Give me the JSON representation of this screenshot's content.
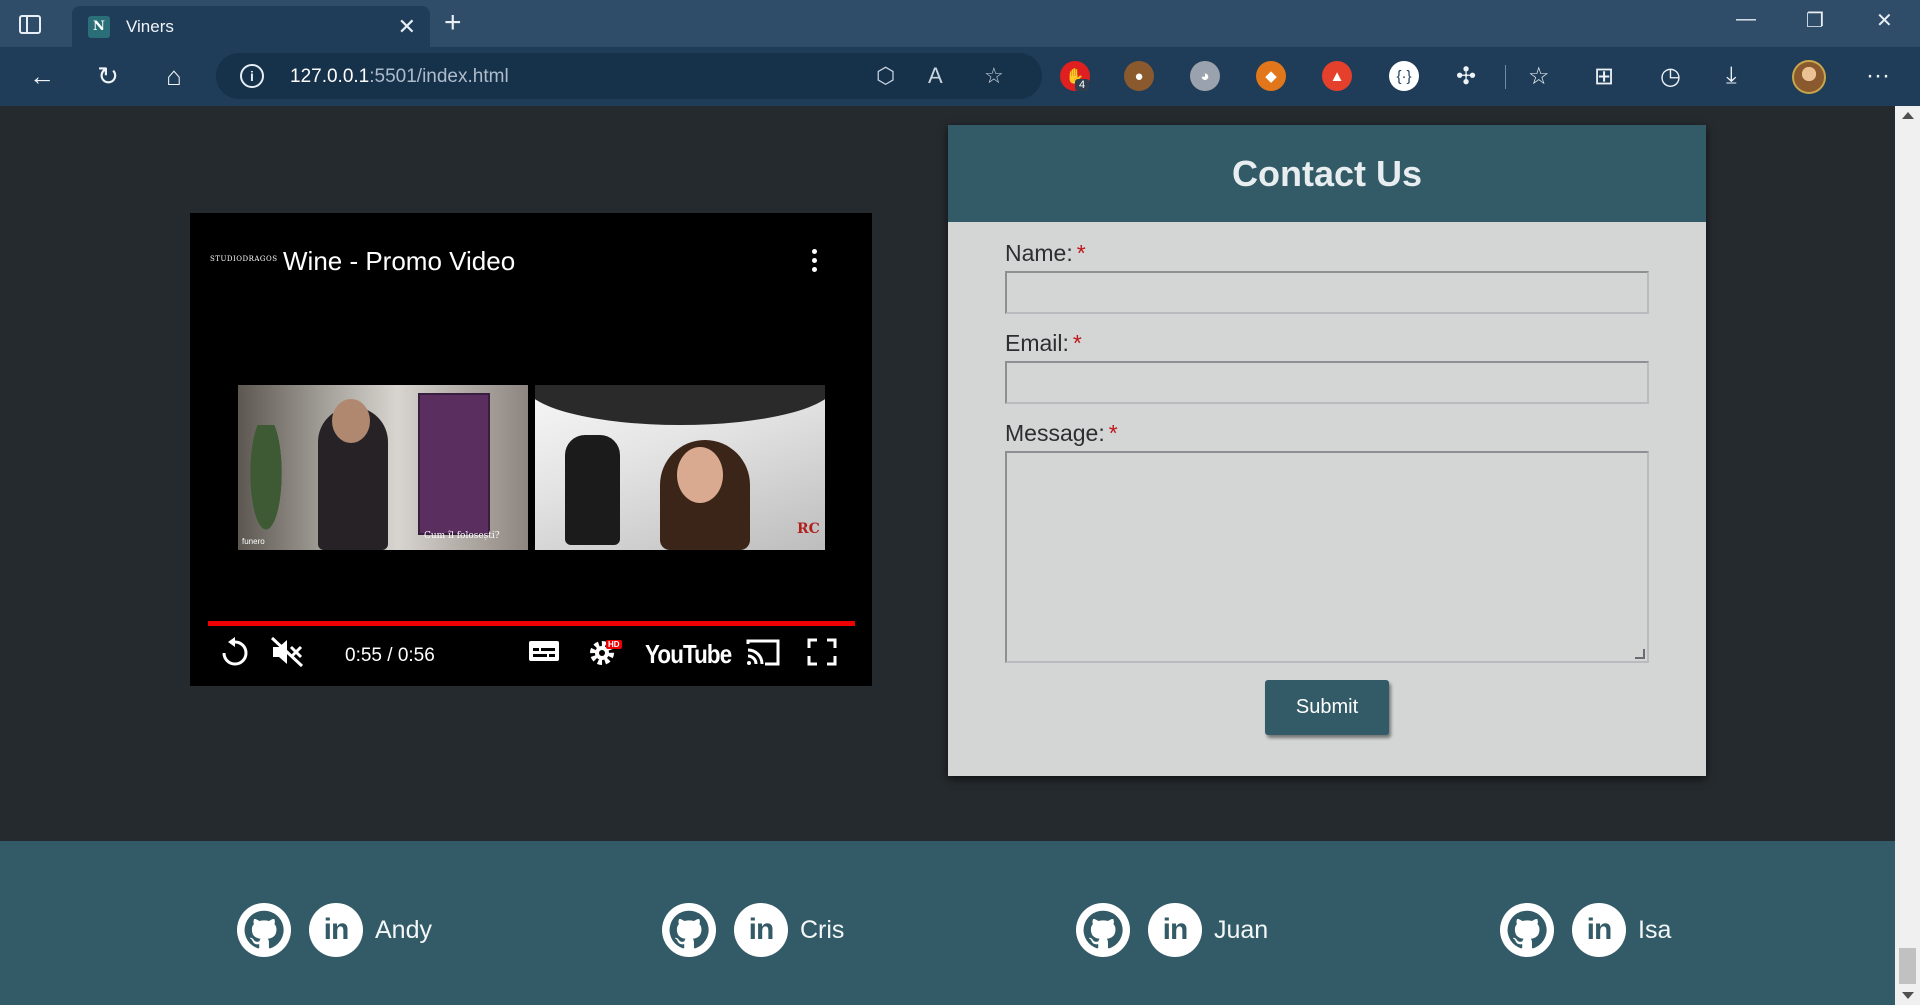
{
  "browser": {
    "tab_title": "Viners",
    "tab_favicon": "N",
    "url_host": "127.0.0.1",
    "url_rest": ":5501/index.html",
    "extension_badge": "4"
  },
  "video": {
    "channel": "STUDIODRAGOS",
    "title": "Wine - Promo Video",
    "time": "0:55 / 0:56",
    "progress": 0.98,
    "thumb_caption": "Cum îl folosești?",
    "thumb_logo": "funero",
    "youtube_label": "YouTube",
    "hd_badge": "HD"
  },
  "contact": {
    "heading": "Contact Us",
    "name_label": "Name:",
    "email_label": "Email:",
    "message_label": "Message:",
    "required_mark": "*",
    "submit_label": "Submit"
  },
  "footer": {
    "members": [
      {
        "name": "Andy",
        "linkedin_label": "in"
      },
      {
        "name": "Cris",
        "linkedin_label": "in"
      },
      {
        "name": "Juan",
        "linkedin_label": "in"
      },
      {
        "name": "Isa",
        "linkedin_label": "in"
      }
    ]
  },
  "colors": {
    "page_bg": "#252a2e",
    "accent": "#335b67",
    "card_bg": "#d4d5d5",
    "required": "#c0161a",
    "progress": "#ee0000"
  }
}
